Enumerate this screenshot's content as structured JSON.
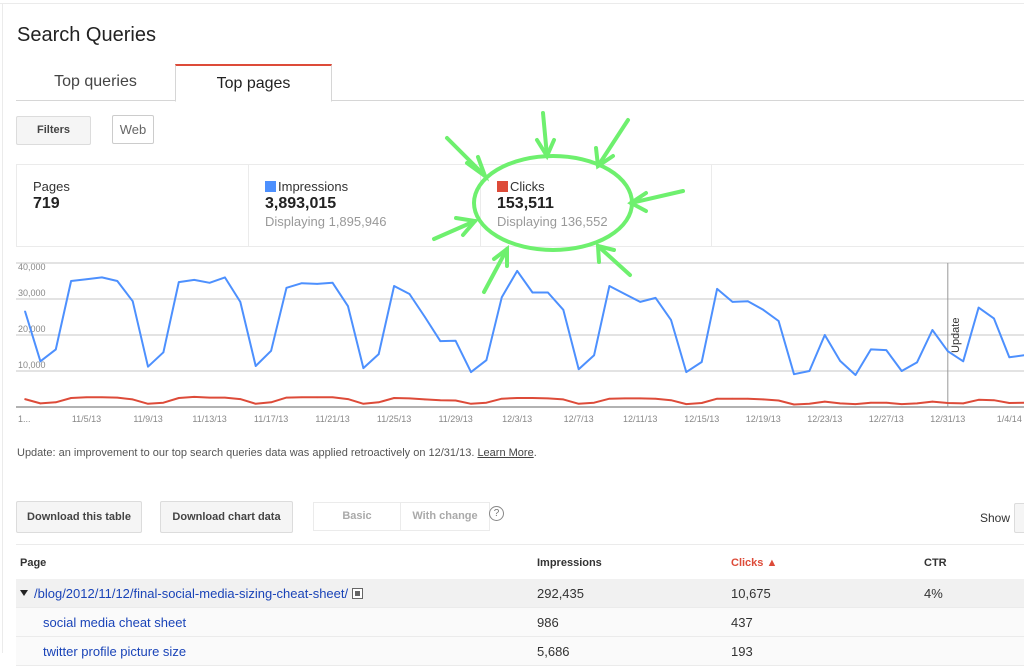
{
  "page_title": "Search Queries",
  "tabs": [
    {
      "label": "Top queries",
      "active": false
    },
    {
      "label": "Top pages",
      "active": true
    }
  ],
  "filters": {
    "button_label": "Filters",
    "chip_label": "Web"
  },
  "summary": {
    "pages": {
      "label": "Pages",
      "value": "719"
    },
    "impressions": {
      "label": "Impressions",
      "value": "3,893,015",
      "displaying": "Displaying 1,895,946",
      "color": "#4d90fe"
    },
    "clicks": {
      "label": "Clicks",
      "value": "153,511",
      "displaying": "Displaying 136,552",
      "color": "#dd4b39"
    }
  },
  "chart_data": {
    "type": "line",
    "title": "",
    "xlabel": "",
    "ylabel": "",
    "ylim": [
      0,
      40000
    ],
    "yticks": [
      10000,
      20000,
      30000,
      40000
    ],
    "ytick_labels": [
      "10,000",
      "20,000",
      "30,000",
      "40,000"
    ],
    "grid": true,
    "x_start_label": "1...",
    "xtick_labels": [
      "11/5/13",
      "11/9/13",
      "11/13/13",
      "11/17/13",
      "11/21/13",
      "11/25/13",
      "11/29/13",
      "12/3/13",
      "12/7/13",
      "12/11/13",
      "12/15/13",
      "12/19/13",
      "12/23/13",
      "12/27/13",
      "12/31/13",
      "1/4/14"
    ],
    "xtick_indices": [
      4,
      8,
      12,
      16,
      20,
      24,
      28,
      32,
      36,
      40,
      44,
      48,
      52,
      56,
      60,
      64
    ],
    "annotation": {
      "label": "Update",
      "index": 60
    },
    "series": [
      {
        "name": "Impressions",
        "color": "#4d90fe",
        "values": [
          26600,
          12700,
          16000,
          35000,
          35500,
          36000,
          35000,
          29400,
          11200,
          15200,
          34700,
          35300,
          34500,
          36000,
          29200,
          11400,
          15600,
          33100,
          34400,
          34200,
          34500,
          28000,
          10800,
          14700,
          33600,
          31400,
          25000,
          18300,
          18400,
          9700,
          13000,
          30500,
          37800,
          31800,
          31800,
          27000,
          10500,
          14400,
          33600,
          31400,
          29200,
          30300,
          24200,
          9700,
          12500,
          32800,
          29200,
          29400,
          27000,
          23900,
          9100,
          10000,
          20000,
          12800,
          8900,
          16000,
          15800,
          10000,
          12400,
          21400,
          15500,
          12700,
          27600,
          24600,
          13800,
          14400
        ]
      },
      {
        "name": "Clicks",
        "color": "#dd4b39",
        "values": [
          2200,
          1000,
          1300,
          2500,
          2700,
          2700,
          2600,
          2100,
          900,
          1200,
          2500,
          2800,
          2600,
          2600,
          2200,
          900,
          1300,
          2600,
          2700,
          2700,
          2700,
          2200,
          900,
          1300,
          2500,
          2400,
          2100,
          1900,
          1800,
          900,
          1200,
          2300,
          2500,
          2500,
          2400,
          2100,
          900,
          1200,
          2300,
          2400,
          2400,
          2300,
          1900,
          800,
          1100,
          2300,
          2300,
          2300,
          2100,
          1800,
          700,
          900,
          1500,
          1000,
          800,
          1200,
          1200,
          800,
          1000,
          1500,
          1100,
          1000,
          2000,
          1900,
          1100,
          1200
        ]
      }
    ]
  },
  "update_note": {
    "text": "Update: an improvement to our top search queries data was applied retroactively on 12/31/13. ",
    "link": "Learn More",
    "tail": "."
  },
  "toolbar": {
    "download_table": "Download this table",
    "download_chart": "Download chart data",
    "view_basic": "Basic",
    "view_with_change": "With change",
    "help": "?",
    "show_label": "Show"
  },
  "table": {
    "columns": [
      "Page",
      "Impressions",
      "Clicks ▲",
      "CTR"
    ],
    "rows": [
      {
        "page": "/blog/2012/11/12/final-social-media-sizing-cheat-sheet/",
        "impressions": "292,435",
        "clicks": "10,675",
        "ctr": "4%",
        "expanded": true
      },
      {
        "page": "social media cheat sheet",
        "impressions": "986",
        "clicks": "437",
        "ctr": ""
      },
      {
        "page": "twitter profile picture size",
        "impressions": "5,686",
        "clicks": "193",
        "ctr": ""
      }
    ]
  },
  "annotation_color": "#6ef06e"
}
